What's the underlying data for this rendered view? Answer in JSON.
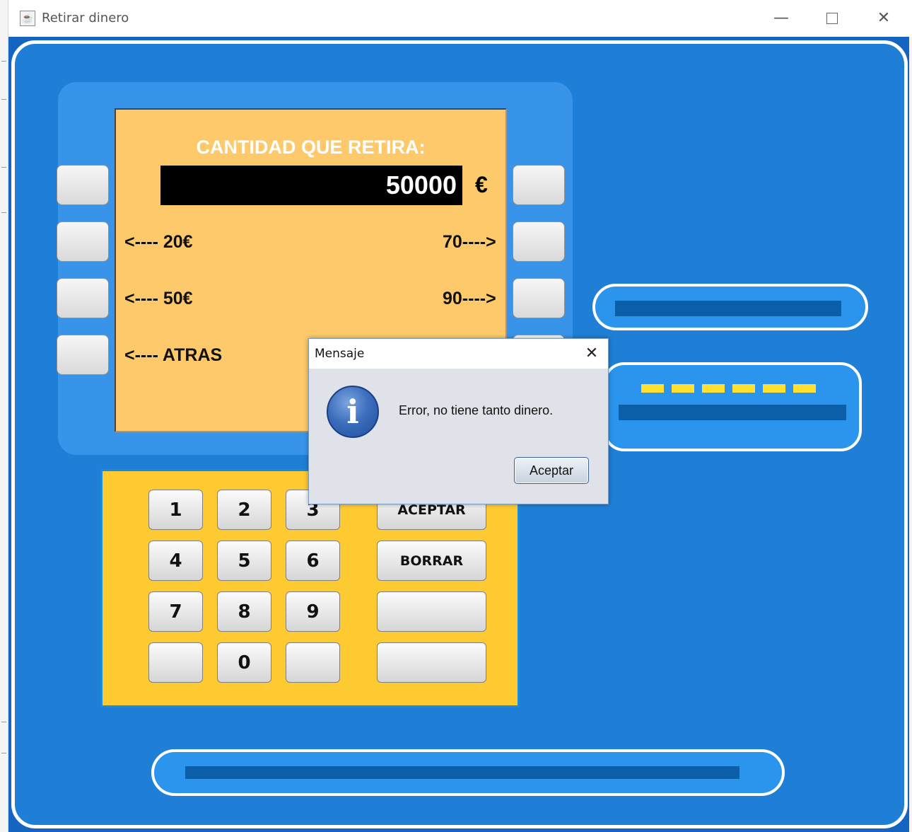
{
  "window": {
    "title": "Retirar dinero",
    "minimize_glyph": "—",
    "close_glyph": "✕",
    "icon": "java-app-icon"
  },
  "screen": {
    "title": "CANTIDAD QUE RETIRA:",
    "amount": "50000",
    "currency": "€",
    "options": {
      "left_20": "<---- 20€",
      "left_50": "<---- 50€",
      "left_back": "<---- ATRAS",
      "right_70": "70---->",
      "right_90": "90---->"
    }
  },
  "keypad": {
    "k1": "1",
    "k2": "2",
    "k3": "3",
    "k4": "4",
    "k5": "5",
    "k6": "6",
    "k7": "7",
    "k8": "8",
    "k9": "9",
    "k0": "0",
    "accept": "ACEPTAR",
    "clear": "BORRAR"
  },
  "dialog": {
    "title": "Mensaje",
    "close_glyph": "✕",
    "icon_glyph": "i",
    "message": "Error, no tiene tanto dinero.",
    "ok": "Aceptar"
  },
  "colors": {
    "background": "#1f7fd6",
    "screen": "#fdc96a",
    "keypad": "#fdca32",
    "slot_bar": "#0a5fa8",
    "pin_dashes": "#ffe033"
  }
}
